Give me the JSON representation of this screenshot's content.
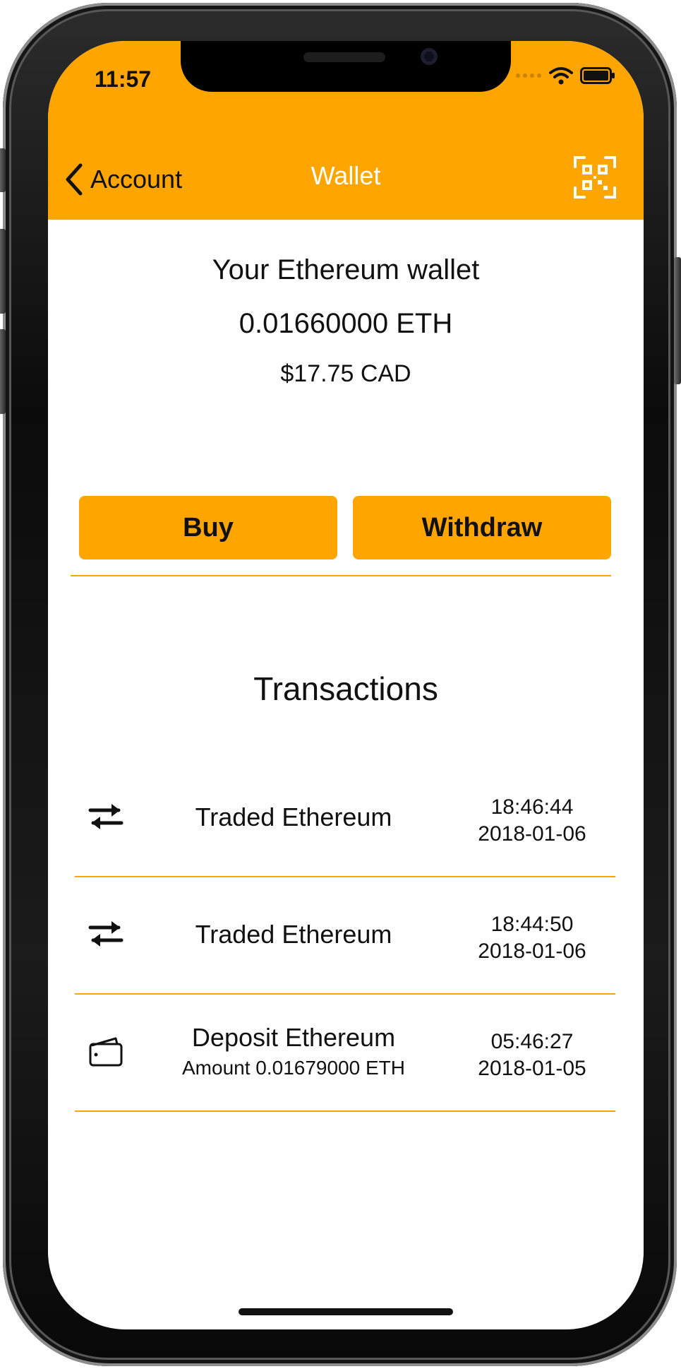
{
  "status_bar": {
    "time": "11:57",
    "icons": [
      "signal-dots-icon",
      "wifi-icon",
      "battery-icon"
    ]
  },
  "navbar": {
    "back_label": "Account",
    "title": "Wallet",
    "right_icon": "qr-code-icon"
  },
  "wallet": {
    "title": "Your Ethereum wallet",
    "eth_balance": "0.01660000 ETH",
    "cad_balance": "$17.75 CAD"
  },
  "actions": {
    "buy_label": "Buy",
    "withdraw_label": "Withdraw"
  },
  "transactions": {
    "heading": "Transactions",
    "items": [
      {
        "icon": "exchange-arrows-icon",
        "title": "Traded Ethereum",
        "subtitle": "",
        "time": "18:46:44",
        "date": "2018-01-06"
      },
      {
        "icon": "exchange-arrows-icon",
        "title": "Traded Ethereum",
        "subtitle": "",
        "time": "18:44:50",
        "date": "2018-01-06"
      },
      {
        "icon": "wallet-icon",
        "title": "Deposit Ethereum",
        "subtitle": "Amount 0.01679000 ETH",
        "time": "05:46:27",
        "date": "2018-01-05"
      }
    ]
  },
  "colors": {
    "accent": "#FFA500",
    "text": "#111111",
    "nav_title": "#FFFFFF"
  }
}
